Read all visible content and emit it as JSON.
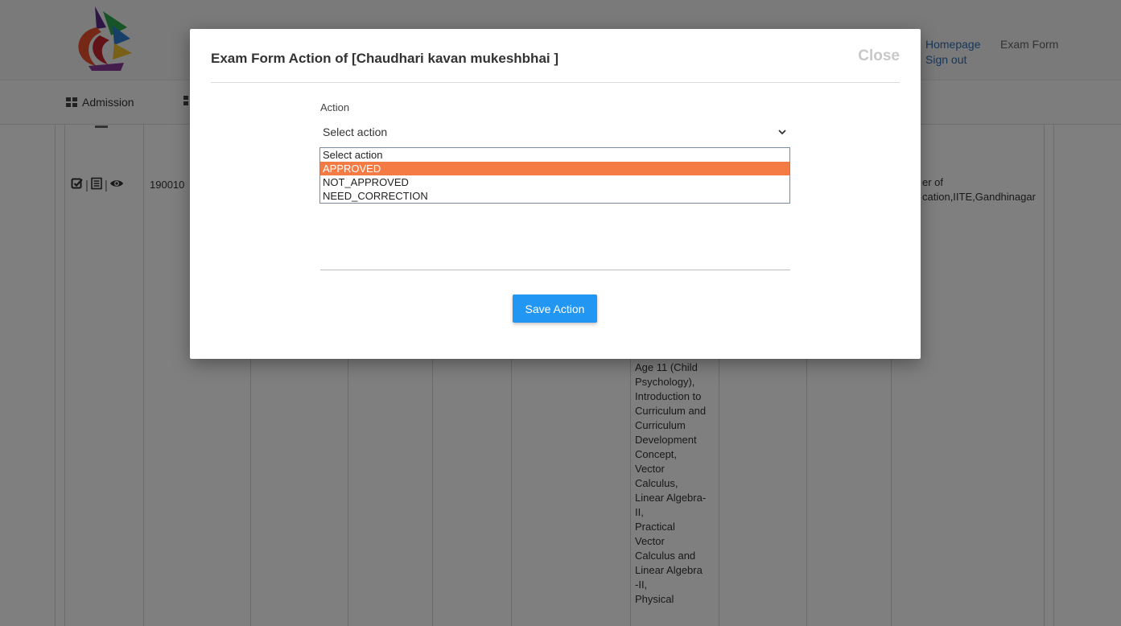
{
  "header": {
    "links": {
      "homepage": "Homepage",
      "exam_form": "Exam Form",
      "sign_out": "Sign out"
    }
  },
  "nav": {
    "items": [
      {
        "label": "Admission",
        "icon": "grid-icon"
      }
    ]
  },
  "table": {
    "row": {
      "id_fragment": "190010",
      "action_icons": [
        "check-square-icon",
        "document-icon",
        "eye-icon"
      ],
      "center_text": [
        "er of",
        "cation,IITE,Gandhinagar"
      ],
      "subjects_text": [
        "Age 11 (Child",
        "Psychology),",
        "Introduction to",
        "Curriculum and",
        "Curriculum",
        "Development",
        "Concept,",
        "Vector",
        "Calculus,",
        "Linear Algebra-",
        "II,",
        "Practical",
        "Vector",
        "Calculus and",
        "Linear Algebra",
        "-II,",
        "Physical"
      ]
    }
  },
  "modal": {
    "title": "Exam Form Action of [Chaudhari kavan mukeshbhai ]",
    "close_label": "Close",
    "action_label": "Action",
    "selected_value": "Select action",
    "options": [
      "Select action",
      "APPROVED",
      "NOT_APPROVED",
      "NEED_CORRECTION"
    ],
    "highlighted_option": "APPROVED",
    "save_label": "Save Action"
  },
  "colors": {
    "primary_button": "#2196f3",
    "highlight": "#f47c44",
    "link": "#2f6db5"
  }
}
